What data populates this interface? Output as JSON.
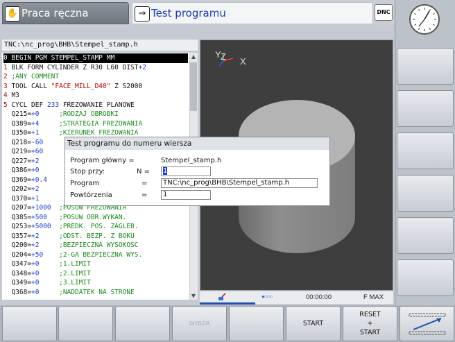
{
  "modes": {
    "manual_label": "Praca ręczna",
    "manual_icon": "hand-icon",
    "test_label": "Test programu",
    "test_icon": "arrow-right-icon"
  },
  "dnc_label": "DNC",
  "file_path": "TNC:\\nc_prog\\BHB\\Stempel_stamp.h",
  "program_lines": [
    {
      "num": "0",
      "code": " BEGIN PGM STEMPEL_STAMP MM"
    },
    {
      "num": "1",
      "code": " BLK FORM CYLINDER Z R30 L60 DIST+2"
    },
    {
      "num": "2",
      "code": " ;ANY COMMENT"
    },
    {
      "num": "3",
      "code": " TOOL CALL \"FACE_MILL_D40\" Z S2000"
    },
    {
      "num": "4",
      "code": " M3"
    },
    {
      "num": "5",
      "code": " CYCL DEF 233 FREZOWANIE PLANOWE"
    },
    {
      "num": "",
      "code": "  Q215=+0     ;RODZAJ OBROBKI"
    },
    {
      "num": "",
      "code": "  Q389=+4     ;STRATEGIA FREZOWANIA"
    },
    {
      "num": "",
      "code": "  Q350=+1     ;KIERUNEK FREZOWANIA"
    },
    {
      "num": "",
      "code": "  Q218=-60"
    },
    {
      "num": "",
      "code": "  Q219=+60"
    },
    {
      "num": "",
      "code": "  Q227=+2"
    },
    {
      "num": "",
      "code": "  Q386=+0"
    },
    {
      "num": "",
      "code": "  Q369=+0.4"
    },
    {
      "num": "",
      "code": "  Q202=+2"
    },
    {
      "num": "",
      "code": "  Q370=+1"
    },
    {
      "num": "",
      "code": "  Q207=+1000  ;POSUW FREZOWANIA"
    },
    {
      "num": "",
      "code": "  Q385=+500   ;POSUW OBR.WYKAN."
    },
    {
      "num": "",
      "code": "  Q253=+5000  ;PREDK. POS. ZAGLEB."
    },
    {
      "num": "",
      "code": "  Q357=+2     ;ODST. BEZP. Z BOKU"
    },
    {
      "num": "",
      "code": "  Q200=+2     ;BEZPIECZNA WYSOKOSC"
    },
    {
      "num": "",
      "code": "  Q204=+50    ;2-GA BEZPIECZNA WYS."
    },
    {
      "num": "",
      "code": "  Q347=+0     ;1.LIMIT"
    },
    {
      "num": "",
      "code": "  Q348=+0     ;2.LIMIT"
    },
    {
      "num": "",
      "code": "  Q349=+0     ;3.LIMIT"
    },
    {
      "num": "",
      "code": "  Q368=+0     ;NADDATEK NA STRONE"
    }
  ],
  "dialog": {
    "title": "Test programu do numeru wiersza",
    "main_program_label": "Program główny =",
    "main_program_value": "Stempel_stamp.h",
    "stop_label": "Stop przy:",
    "n_label": "N =",
    "n_value": "1",
    "program_label": "Program",
    "program_eq": "=",
    "program_value": "TNC:\\nc_prog\\BHB\\Stempel_stamp.h",
    "repeat_label": "Powtórzenia",
    "repeat_eq": "=",
    "repeat_value": "1"
  },
  "graphic": {
    "axis_y": "Y",
    "axis_z": "Z",
    "axis_x": "X"
  },
  "status": {
    "dots": "●○○○",
    "time": "00:00:00",
    "feed": "F MAX"
  },
  "softkeys": {
    "k4": "WYBÓR",
    "k6": "START",
    "k7_line1": "RESET",
    "k7_line2": "+",
    "k7_line3": "START"
  },
  "colors": {
    "accent_blue": "#1a3bb8",
    "line_number_red": "#c00000",
    "comment_green": "#1a8a1a"
  }
}
